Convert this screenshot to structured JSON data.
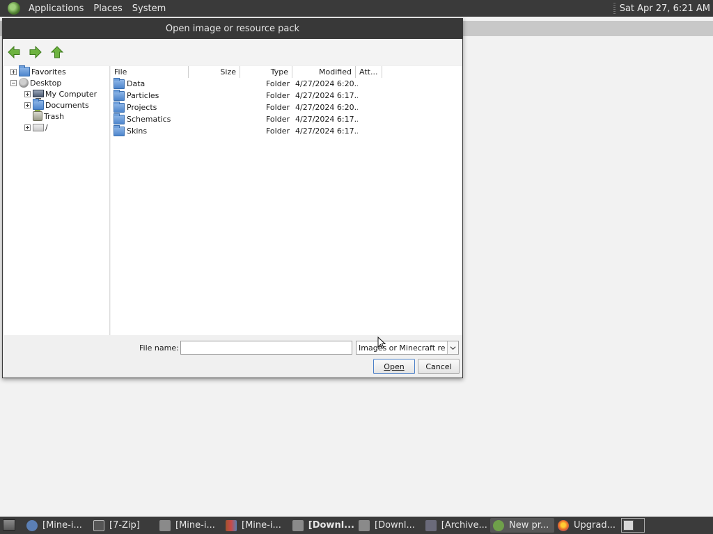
{
  "top_panel": {
    "menus": [
      "Applications",
      "Places",
      "System"
    ],
    "clock": "Sat Apr 27,  6:21 AM"
  },
  "dialog": {
    "title": "Open image or resource pack",
    "toolbar": {
      "back_icon": "back-arrow-icon",
      "forward_icon": "forward-arrow-icon",
      "up_icon": "up-arrow-icon"
    },
    "tree": [
      {
        "label": "Favorites",
        "icon": "folder-icon",
        "toggle": "plus"
      },
      {
        "label": "Desktop",
        "icon": "desktop-icon",
        "toggle": "minus"
      },
      {
        "label": "My Computer",
        "icon": "computer-icon",
        "toggle": "plus"
      },
      {
        "label": "Documents",
        "icon": "folder-icon",
        "toggle": "plus"
      },
      {
        "label": "Trash",
        "icon": "trash-icon",
        "toggle": "none"
      },
      {
        "label": "/",
        "icon": "drive-icon",
        "toggle": "plus"
      }
    ],
    "columns": [
      "File",
      "Size",
      "Type",
      "Modified",
      "Att..."
    ],
    "files": [
      {
        "name": "Data",
        "type": "Folder",
        "modified": "4/27/2024 6:20..."
      },
      {
        "name": "Particles",
        "type": "Folder",
        "modified": "4/27/2024 6:17..."
      },
      {
        "name": "Projects",
        "type": "Folder",
        "modified": "4/27/2024 6:20..."
      },
      {
        "name": "Schematics",
        "type": "Folder",
        "modified": "4/27/2024 6:17..."
      },
      {
        "name": "Skins",
        "type": "Folder",
        "modified": "4/27/2024 6:17..."
      }
    ],
    "file_name_label": "File name:",
    "file_name_value": "",
    "filter_value": "Images or Minecraft resource packs",
    "open_label": "Open",
    "cancel_label": "Cancel"
  },
  "taskbar": {
    "tasks": [
      {
        "label": "[Mine-i...",
        "icon": "browser-icon",
        "color": "#5b7fb5"
      },
      {
        "label": "[7-Zip]",
        "icon": "7zip-icon",
        "color": "#555555"
      },
      {
        "label": "[Mine-i...",
        "icon": "folder-icon",
        "color": "#8a8a8a"
      },
      {
        "label": "[Mine-i...",
        "icon": "archive-icon",
        "color": "#a0522d"
      },
      {
        "label": "[Downl...",
        "icon": "folder-icon",
        "color": "#8a8a8a",
        "bold": true
      },
      {
        "label": "[Downl...",
        "icon": "folder-icon",
        "color": "#8a8a8a"
      },
      {
        "label": "[Archive...",
        "icon": "archive-manager-icon",
        "color": "#6a6a7a"
      },
      {
        "label": "New pr...",
        "icon": "mineimator-icon",
        "color": "#6fa04a",
        "active": true
      },
      {
        "label": "Upgrad...",
        "icon": "firefox-icon",
        "color": "#e6692a"
      }
    ]
  }
}
